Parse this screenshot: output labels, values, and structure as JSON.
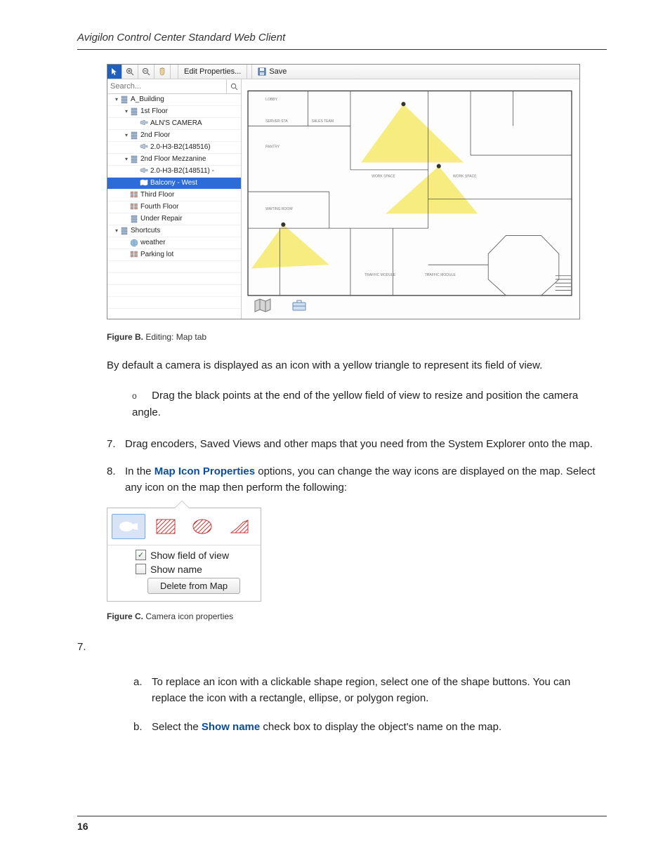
{
  "header": {
    "title": "Avigilon Control Center Standard Web Client"
  },
  "footer": {
    "page_number": "16"
  },
  "screenshot1": {
    "toolbar": {
      "edit_properties": "Edit Properties...",
      "save": "Save"
    },
    "search_placeholder": "Search...",
    "tree": [
      {
        "indent": 0,
        "expander": "▾",
        "icon": "server",
        "label": "A_Building"
      },
      {
        "indent": 1,
        "expander": "▾",
        "icon": "server",
        "label": "1st Floor"
      },
      {
        "indent": 2,
        "expander": "",
        "icon": "camera",
        "label": "ALN'S CAMERA"
      },
      {
        "indent": 1,
        "expander": "▾",
        "icon": "server",
        "label": "2nd Floor"
      },
      {
        "indent": 2,
        "expander": "",
        "icon": "camera",
        "label": "2.0-H3-B2(148516)"
      },
      {
        "indent": 1,
        "expander": "▾",
        "icon": "server",
        "label": "2nd Floor Mezzanine"
      },
      {
        "indent": 2,
        "expander": "",
        "icon": "camera",
        "label": "2.0-H3-B2(148511) -"
      },
      {
        "indent": 2,
        "expander": "",
        "icon": "map",
        "label": "Balcony - West",
        "selected": true
      },
      {
        "indent": 1,
        "expander": "",
        "icon": "view",
        "label": "Third Floor"
      },
      {
        "indent": 1,
        "expander": "",
        "icon": "view",
        "label": "Fourth Floor"
      },
      {
        "indent": 1,
        "expander": "",
        "icon": "server",
        "label": "Under Repair"
      },
      {
        "indent": 0,
        "expander": "▾",
        "icon": "server",
        "label": "Shortcuts"
      },
      {
        "indent": 1,
        "expander": "",
        "icon": "web",
        "label": "weather"
      },
      {
        "indent": 1,
        "expander": "",
        "icon": "view",
        "label": "Parking lot"
      }
    ]
  },
  "figureB": {
    "label": "Figure B.",
    "caption": "Editing: Map tab"
  },
  "paragraph1": "By default a camera is displayed as an icon with a yellow triangle to represent its field of view.",
  "bullet1": "Drag the black points at the end of the yellow field of view to resize and position the camera angle.",
  "step7": "Drag encoders, Saved Views and other maps that you need from the System Explorer onto the map.",
  "step8_prefix": "In the ",
  "step8_bold": "Map Icon Properties",
  "step8_suffix": " options, you can change the way icons are displayed on the map. Select any icon on the map then perform the following:",
  "popover": {
    "show_fov": "Show field of view",
    "show_name": "Show name",
    "delete": "Delete from Map"
  },
  "figureC": {
    "label": "Figure C.",
    "caption": "Camera icon properties"
  },
  "loose7": "7.",
  "letter_a": "To replace an icon with a clickable shape region, select one of the shape buttons. You can replace the icon with a rectangle, ellipse, or polygon region.",
  "letter_b_prefix": "Select the ",
  "letter_b_bold": "Show name",
  "letter_b_suffix": " check box to display the object's name on the map."
}
